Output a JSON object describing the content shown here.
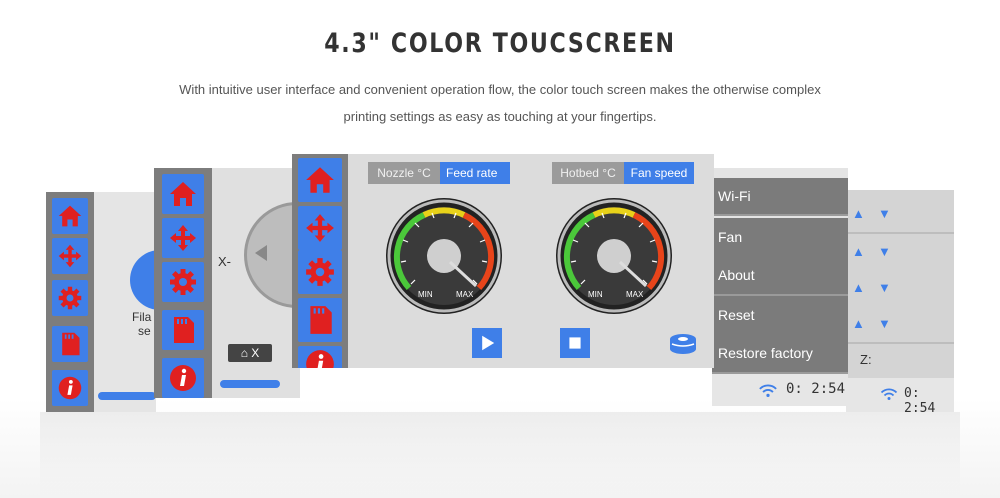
{
  "header": {
    "title": "4.3\" COLOR TOUCSCREEN",
    "subtitle_line1": "With intuitive user interface and convenient operation flow, the color touch screen makes the otherwise complex",
    "subtitle_line2": "printing settings as easy as touching at your fingertips."
  },
  "screen_left": {
    "label_line1": "Fila",
    "label_line2": "se"
  },
  "screen_move": {
    "axis_label": "X-",
    "home_label": "X"
  },
  "screen_center": {
    "tabs_left": [
      "Nozzle °C",
      "Feed rate"
    ],
    "tabs_right": [
      "Hotbed °C",
      "Fan speed"
    ],
    "gauge_min": "MIN",
    "gauge_max": "MAX"
  },
  "screen_settings": {
    "menu": [
      "Wi-Fi",
      "Fan",
      "About",
      "Reset",
      "Restore factory"
    ],
    "time": "0: 2:54"
  },
  "screen_axes": {
    "z_label": "Z:",
    "time": "0: 2:54"
  },
  "colors": {
    "accent": "#3f7fe8",
    "icon_red": "#e02020",
    "sidebar": "#7d7d7d"
  }
}
